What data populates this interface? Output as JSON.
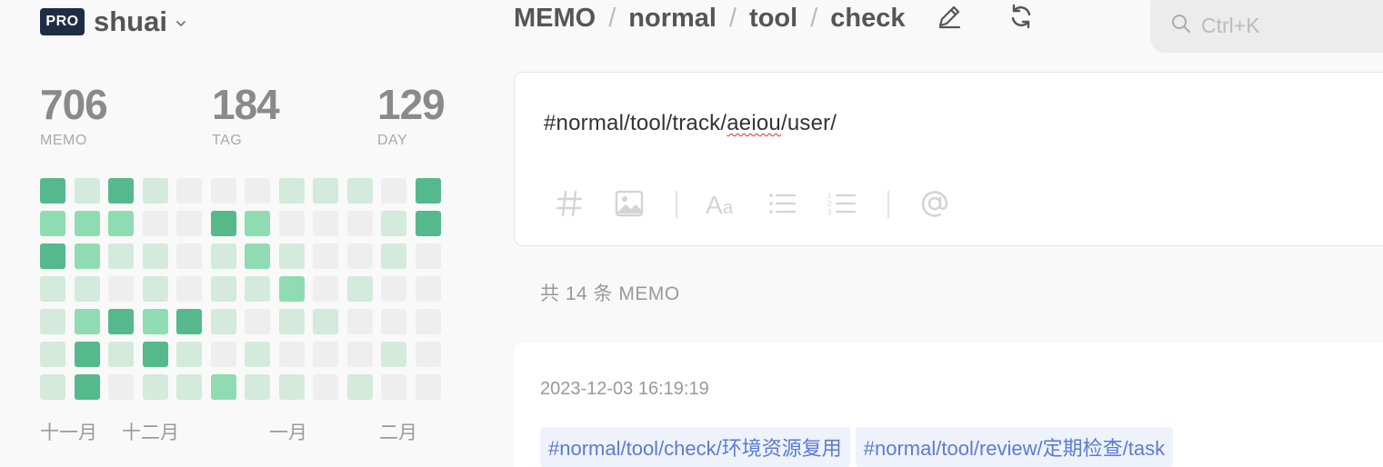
{
  "user": {
    "badge": "PRO",
    "name": "shuai"
  },
  "stats": [
    {
      "value": "706",
      "label": "MEMO"
    },
    {
      "value": "184",
      "label": "TAG"
    },
    {
      "value": "129",
      "label": "DAY"
    }
  ],
  "heatmap": {
    "colors": [
      "#eeeeee",
      "#d3eadc",
      "#8fdcb2",
      "#55b98d"
    ],
    "levels": [
      [
        3,
        1,
        3,
        1,
        0,
        0,
        0,
        1,
        1,
        1,
        0,
        3
      ],
      [
        2,
        2,
        2,
        0,
        0,
        3,
        2,
        0,
        0,
        0,
        1,
        3
      ],
      [
        3,
        2,
        1,
        1,
        0,
        1,
        2,
        1,
        0,
        0,
        1,
        0
      ],
      [
        1,
        1,
        0,
        1,
        0,
        1,
        1,
        2,
        0,
        1,
        0,
        0
      ],
      [
        1,
        2,
        3,
        2,
        3,
        1,
        0,
        1,
        1,
        0,
        0,
        0
      ],
      [
        1,
        3,
        1,
        3,
        1,
        0,
        1,
        0,
        0,
        0,
        1,
        0
      ],
      [
        1,
        3,
        0,
        1,
        1,
        2,
        1,
        1,
        0,
        1,
        0,
        0
      ]
    ],
    "months": [
      "十一月",
      "十二月",
      "一月",
      "二月"
    ]
  },
  "breadcrumb": [
    "MEMO",
    "normal",
    "tool",
    "check"
  ],
  "header_icons": [
    "edit-icon",
    "refresh-icon"
  ],
  "search": {
    "placeholder": "Ctrl+K"
  },
  "editor": {
    "text_before": "#normal/tool/track/",
    "text_misspelled": "aeiou",
    "text_after": "/user/",
    "tools": [
      "hash-icon",
      "image-icon",
      "font-size-icon",
      "bullet-list-icon",
      "numbered-list-icon",
      "mention-icon"
    ]
  },
  "count": {
    "prefix": "共",
    "number": "14",
    "suffix": "条 MEMO"
  },
  "memo": {
    "timestamp": "2023-12-03 16:19:19",
    "tags": [
      "#normal/tool/check/环境资源复用",
      "#normal/tool/review/定期检查/task"
    ]
  }
}
